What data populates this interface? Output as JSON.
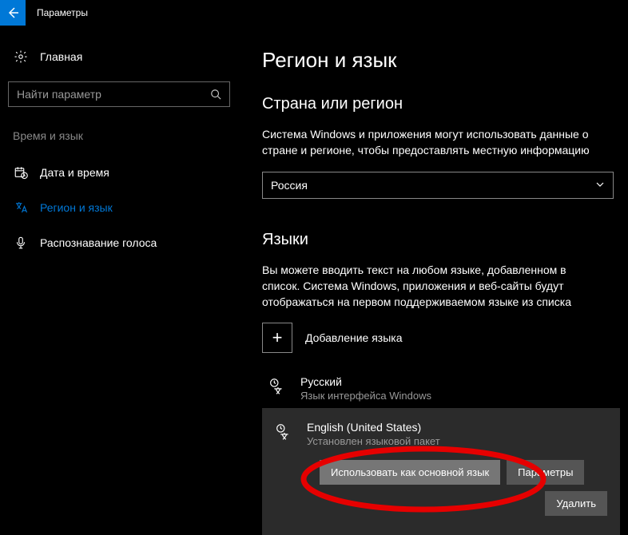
{
  "titlebar": {
    "title": "Параметры"
  },
  "sidebar": {
    "home": "Главная",
    "search_placeholder": "Найти параметр",
    "category": "Время и язык",
    "items": [
      {
        "label": "Дата и время"
      },
      {
        "label": "Регион и язык"
      },
      {
        "label": "Распознавание голоса"
      }
    ]
  },
  "main": {
    "heading": "Регион и язык",
    "country_heading": "Страна или регион",
    "country_desc": "Система Windows и приложения могут использовать данные о стране и регионе, чтобы предоставлять местную информацию",
    "country_value": "Россия",
    "languages_heading": "Языки",
    "languages_desc": "Вы можете вводить текст на любом языке, добавленном в список. Система Windows, приложения и веб-сайты будут отображаться на первом поддерживаемом языке из списка",
    "add_language": "Добавление языка",
    "langs": [
      {
        "name": "Русский",
        "sub": "Язык интерфейса Windows"
      },
      {
        "name": "English (United States)",
        "sub": "Установлен языковой пакет"
      }
    ],
    "buttons": {
      "set_default": "Использовать как основной язык",
      "options": "Параметры",
      "remove": "Удалить"
    }
  }
}
